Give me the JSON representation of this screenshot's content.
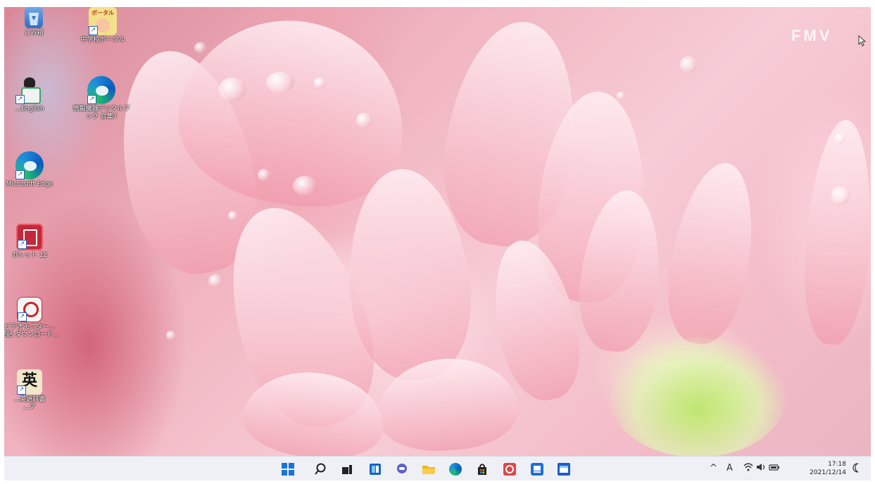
{
  "wallpaper": {
    "brand": "FMV"
  },
  "desktop": {
    "icons": [
      {
        "label": "ごみ箱",
        "icon": "recycle-bin-icon"
      },
      {
        "label": "中学校ポータル",
        "icon": "portal-icon",
        "icon_text": "ポータル"
      },
      {
        "label": "...English",
        "icon": "english-app-icon"
      },
      {
        "label": "情報機器デジタルブ\nック 合集7",
        "icon": "edge-digital-book-icon"
      },
      {
        "label": "Microsoft Edge",
        "icon": "edge-icon"
      },
      {
        "label": "ガレット 12",
        "icon": "app-12-icon"
      },
      {
        "label": "ビデオモニター...\n通話 ダウンロード...",
        "icon": "download-app-icon"
      },
      {
        "label": "...英語辞書\n...ア",
        "icon": "english-dictionary-icon",
        "icon_text": "英"
      }
    ]
  },
  "taskbar": {
    "buttons": [
      {
        "name": "start",
        "icon": "windows-start-icon"
      },
      {
        "name": "search",
        "icon": "search-icon"
      },
      {
        "name": "task-view",
        "icon": "task-view-icon"
      },
      {
        "name": "widgets",
        "icon": "widgets-icon"
      },
      {
        "name": "chat",
        "icon": "chat-icon"
      },
      {
        "name": "file-explorer",
        "icon": "folder-icon"
      },
      {
        "name": "edge",
        "icon": "edge-icon"
      },
      {
        "name": "store",
        "icon": "store-icon"
      },
      {
        "name": "app-circle",
        "icon": "app-circle-icon"
      },
      {
        "name": "app-blue-1",
        "icon": "app-blue-icon"
      },
      {
        "name": "app-blue-2",
        "icon": "app-window-icon"
      }
    ],
    "tray": {
      "chevron": "^",
      "ime": "A",
      "time": "17:18",
      "date": "2021/12/14"
    }
  }
}
